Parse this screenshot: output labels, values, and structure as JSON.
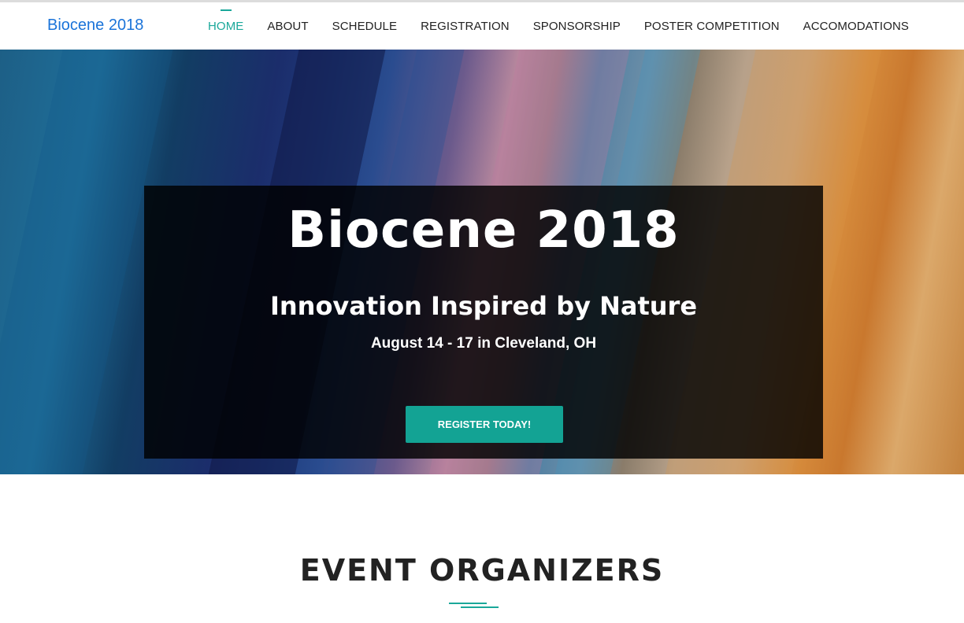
{
  "header": {
    "brand": "Biocene 2018",
    "nav": [
      {
        "label": "HOME",
        "active": true
      },
      {
        "label": "ABOUT"
      },
      {
        "label": "SCHEDULE"
      },
      {
        "label": "REGISTRATION"
      },
      {
        "label": "SPONSORSHIP"
      },
      {
        "label": "POSTER COMPETITION"
      },
      {
        "label": "ACCOMODATIONS"
      }
    ]
  },
  "hero": {
    "title": "Biocene 2018",
    "subtitle": "Innovation Inspired by Nature",
    "date_location": "August 14 - 17 in Cleveland, OH",
    "cta_label": "REGISTER TODAY!"
  },
  "section": {
    "title": "EVENT ORGANIZERS"
  },
  "colors": {
    "accent": "#1aa89a",
    "brand": "#1a73d9",
    "button": "#13a394"
  }
}
